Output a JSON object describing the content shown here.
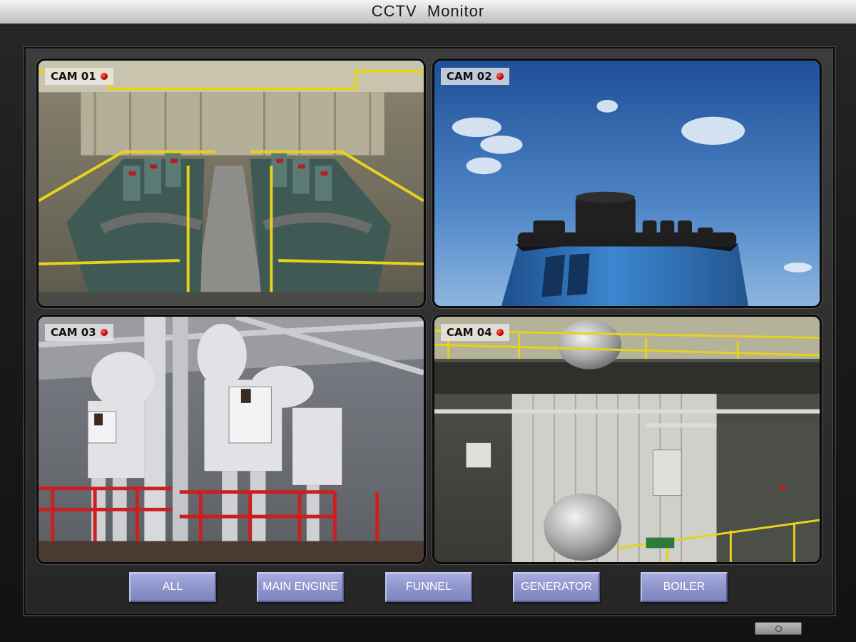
{
  "window": {
    "title": "CCTV  Monitor"
  },
  "cameras": [
    {
      "label": "CAM 01",
      "recording": true
    },
    {
      "label": "CAM 02",
      "recording": true
    },
    {
      "label": "CAM 03",
      "recording": true
    },
    {
      "label": "CAM 04",
      "recording": true
    }
  ],
  "buttons": [
    {
      "label": "ALL"
    },
    {
      "label": "MAIN ENGINE"
    },
    {
      "label": "FUNNEL"
    },
    {
      "label": "GENERATOR"
    },
    {
      "label": "BOILER"
    }
  ],
  "colors": {
    "button_fill": "#8f95cc",
    "recording_dot": "#c00000",
    "railing_yellow": "#e7d21c",
    "railing_red": "#cc1f1f",
    "funnel_blue": "#2f6fb0"
  },
  "icons": {
    "power": "power-icon"
  }
}
